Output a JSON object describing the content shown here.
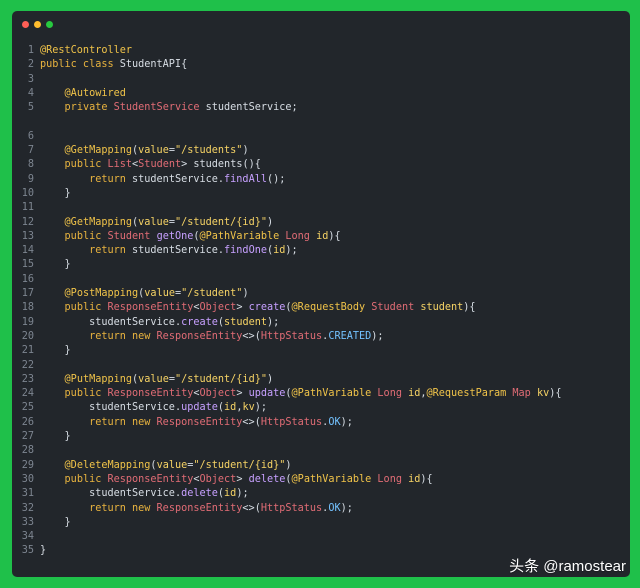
{
  "window": {
    "accent_colors": {
      "background": "#1fc04a",
      "editor": "#22262b"
    },
    "traffic_lights": [
      "close",
      "minimize",
      "zoom"
    ]
  },
  "watermark": "头条 @ramostear",
  "code_lines": [
    {
      "n": "1",
      "tokens": [
        [
          "an",
          "@RestController"
        ]
      ]
    },
    {
      "n": "2",
      "tokens": [
        [
          "kw",
          "public class "
        ],
        [
          "tx",
          "StudentAPI"
        ],
        [
          "pn",
          "{"
        ]
      ]
    },
    {
      "n": "3",
      "tokens": []
    },
    {
      "n": "4",
      "tokens": [
        [
          "pn",
          "    "
        ],
        [
          "an",
          "@Autowired"
        ]
      ]
    },
    {
      "n": "5",
      "tokens": [
        [
          "pn",
          "    "
        ],
        [
          "kw",
          "private "
        ],
        [
          "ty",
          "StudentService "
        ],
        [
          "tx",
          "studentService"
        ],
        [
          "pn",
          ";"
        ]
      ]
    },
    {
      "n": "",
      "tokens": []
    },
    {
      "n": "6",
      "tokens": []
    },
    {
      "n": "7",
      "tokens": [
        [
          "pn",
          "    "
        ],
        [
          "an",
          "@GetMapping"
        ],
        [
          "pn",
          "("
        ],
        [
          "pm",
          "value"
        ],
        [
          "pn",
          "="
        ],
        [
          "str",
          "\"/students\""
        ],
        [
          "pn",
          ")"
        ]
      ]
    },
    {
      "n": "8",
      "tokens": [
        [
          "pn",
          "    "
        ],
        [
          "kw",
          "public "
        ],
        [
          "ty",
          "List"
        ],
        [
          "pn",
          "<"
        ],
        [
          "ty",
          "Student"
        ],
        [
          "pn",
          "> "
        ],
        [
          "tx",
          "students"
        ],
        [
          "pn",
          "(){"
        ]
      ]
    },
    {
      "n": "9",
      "tokens": [
        [
          "pn",
          "        "
        ],
        [
          "kw",
          "return "
        ],
        [
          "tx",
          "studentService"
        ],
        [
          "pn",
          "."
        ],
        [
          "fn",
          "findAll"
        ],
        [
          "pn",
          "();"
        ]
      ]
    },
    {
      "n": "10",
      "tokens": [
        [
          "pn",
          "    }"
        ]
      ]
    },
    {
      "n": "11",
      "tokens": []
    },
    {
      "n": "12",
      "tokens": [
        [
          "pn",
          "    "
        ],
        [
          "an",
          "@GetMapping"
        ],
        [
          "pn",
          "("
        ],
        [
          "pm",
          "value"
        ],
        [
          "pn",
          "="
        ],
        [
          "str",
          "\"/student/{id}\""
        ],
        [
          "pn",
          ")"
        ]
      ]
    },
    {
      "n": "13",
      "tokens": [
        [
          "pn",
          "    "
        ],
        [
          "kw",
          "public "
        ],
        [
          "ty",
          "Student "
        ],
        [
          "fn",
          "getOne"
        ],
        [
          "pn",
          "("
        ],
        [
          "an",
          "@PathVariable "
        ],
        [
          "ty",
          "Long "
        ],
        [
          "pm",
          "id"
        ],
        [
          "pn",
          "){"
        ]
      ]
    },
    {
      "n": "14",
      "tokens": [
        [
          "pn",
          "        "
        ],
        [
          "kw",
          "return "
        ],
        [
          "tx",
          "studentService"
        ],
        [
          "pn",
          "."
        ],
        [
          "fn",
          "findOne"
        ],
        [
          "pn",
          "("
        ],
        [
          "pm",
          "id"
        ],
        [
          "pn",
          ");"
        ]
      ]
    },
    {
      "n": "15",
      "tokens": [
        [
          "pn",
          "    }"
        ]
      ]
    },
    {
      "n": "16",
      "tokens": []
    },
    {
      "n": "17",
      "tokens": [
        [
          "pn",
          "    "
        ],
        [
          "an",
          "@PostMapping"
        ],
        [
          "pn",
          "("
        ],
        [
          "pm",
          "value"
        ],
        [
          "pn",
          "="
        ],
        [
          "str",
          "\"/student\""
        ],
        [
          "pn",
          ")"
        ]
      ]
    },
    {
      "n": "18",
      "tokens": [
        [
          "pn",
          "    "
        ],
        [
          "kw",
          "public "
        ],
        [
          "ty",
          "ResponseEntity"
        ],
        [
          "pn",
          "<"
        ],
        [
          "ty",
          "Object"
        ],
        [
          "pn",
          "> "
        ],
        [
          "fn",
          "create"
        ],
        [
          "pn",
          "("
        ],
        [
          "an",
          "@RequestBody "
        ],
        [
          "ty",
          "Student "
        ],
        [
          "pm",
          "student"
        ],
        [
          "pn",
          "){"
        ]
      ]
    },
    {
      "n": "19",
      "tokens": [
        [
          "pn",
          "        "
        ],
        [
          "tx",
          "studentService"
        ],
        [
          "pn",
          "."
        ],
        [
          "fn",
          "create"
        ],
        [
          "pn",
          "("
        ],
        [
          "pm",
          "student"
        ],
        [
          "pn",
          ");"
        ]
      ]
    },
    {
      "n": "20",
      "tokens": [
        [
          "pn",
          "        "
        ],
        [
          "kw",
          "return new "
        ],
        [
          "ty",
          "ResponseEntity"
        ],
        [
          "pn",
          "<>("
        ],
        [
          "ty",
          "HttpStatus"
        ],
        [
          "pn",
          "."
        ],
        [
          "cst",
          "CREATED"
        ],
        [
          "pn",
          ");"
        ]
      ]
    },
    {
      "n": "21",
      "tokens": [
        [
          "pn",
          "    }"
        ]
      ]
    },
    {
      "n": "22",
      "tokens": []
    },
    {
      "n": "23",
      "tokens": [
        [
          "pn",
          "    "
        ],
        [
          "an",
          "@PutMapping"
        ],
        [
          "pn",
          "("
        ],
        [
          "pm",
          "value"
        ],
        [
          "pn",
          "="
        ],
        [
          "str",
          "\"/student/{id}\""
        ],
        [
          "pn",
          ")"
        ]
      ]
    },
    {
      "n": "24",
      "tokens": [
        [
          "pn",
          "    "
        ],
        [
          "kw",
          "public "
        ],
        [
          "ty",
          "ResponseEntity"
        ],
        [
          "pn",
          "<"
        ],
        [
          "ty",
          "Object"
        ],
        [
          "pn",
          "> "
        ],
        [
          "fn",
          "update"
        ],
        [
          "pn",
          "("
        ],
        [
          "an",
          "@PathVariable "
        ],
        [
          "ty",
          "Long "
        ],
        [
          "pm",
          "id"
        ],
        [
          "pn",
          ","
        ],
        [
          "an",
          "@RequestParam "
        ],
        [
          "ty",
          "Map "
        ],
        [
          "pm",
          "kv"
        ],
        [
          "pn",
          "){"
        ]
      ]
    },
    {
      "n": "25",
      "tokens": [
        [
          "pn",
          "        "
        ],
        [
          "tx",
          "studentService"
        ],
        [
          "pn",
          "."
        ],
        [
          "fn",
          "update"
        ],
        [
          "pn",
          "("
        ],
        [
          "pm",
          "id"
        ],
        [
          "pn",
          ","
        ],
        [
          "pm",
          "kv"
        ],
        [
          "pn",
          ");"
        ]
      ]
    },
    {
      "n": "26",
      "tokens": [
        [
          "pn",
          "        "
        ],
        [
          "kw",
          "return new "
        ],
        [
          "ty",
          "ResponseEntity"
        ],
        [
          "pn",
          "<>("
        ],
        [
          "ty",
          "HttpStatus"
        ],
        [
          "pn",
          "."
        ],
        [
          "cst",
          "OK"
        ],
        [
          "pn",
          ");"
        ]
      ]
    },
    {
      "n": "27",
      "tokens": [
        [
          "pn",
          "    }"
        ]
      ]
    },
    {
      "n": "28",
      "tokens": []
    },
    {
      "n": "29",
      "tokens": [
        [
          "pn",
          "    "
        ],
        [
          "an",
          "@DeleteMapping"
        ],
        [
          "pn",
          "("
        ],
        [
          "pm",
          "value"
        ],
        [
          "pn",
          "="
        ],
        [
          "str",
          "\"/student/{id}\""
        ],
        [
          "pn",
          ")"
        ]
      ]
    },
    {
      "n": "30",
      "tokens": [
        [
          "pn",
          "    "
        ],
        [
          "kw",
          "public "
        ],
        [
          "ty",
          "ResponseEntity"
        ],
        [
          "pn",
          "<"
        ],
        [
          "ty",
          "Object"
        ],
        [
          "pn",
          "> "
        ],
        [
          "fn",
          "delete"
        ],
        [
          "pn",
          "("
        ],
        [
          "an",
          "@PathVariable "
        ],
        [
          "ty",
          "Long "
        ],
        [
          "pm",
          "id"
        ],
        [
          "pn",
          "){"
        ]
      ]
    },
    {
      "n": "31",
      "tokens": [
        [
          "pn",
          "        "
        ],
        [
          "tx",
          "studentService"
        ],
        [
          "pn",
          "."
        ],
        [
          "fn",
          "delete"
        ],
        [
          "pn",
          "("
        ],
        [
          "pm",
          "id"
        ],
        [
          "pn",
          ");"
        ]
      ]
    },
    {
      "n": "32",
      "tokens": [
        [
          "pn",
          "        "
        ],
        [
          "kw",
          "return new "
        ],
        [
          "ty",
          "ResponseEntity"
        ],
        [
          "pn",
          "<>("
        ],
        [
          "ty",
          "HttpStatus"
        ],
        [
          "pn",
          "."
        ],
        [
          "cst",
          "OK"
        ],
        [
          "pn",
          ");"
        ]
      ]
    },
    {
      "n": "33",
      "tokens": [
        [
          "pn",
          "    }"
        ]
      ]
    },
    {
      "n": "34",
      "tokens": []
    },
    {
      "n": "35",
      "tokens": [
        [
          "pn",
          "}"
        ]
      ]
    }
  ]
}
